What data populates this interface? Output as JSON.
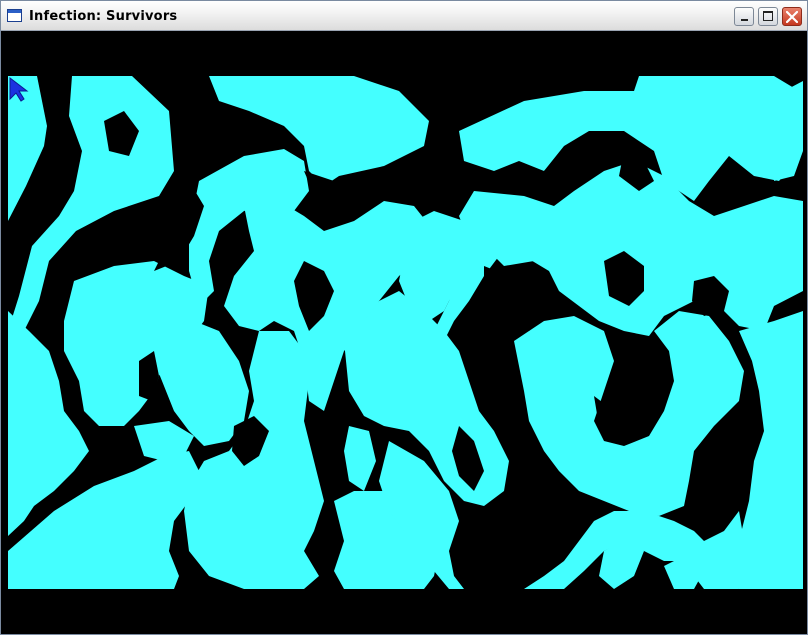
{
  "window": {
    "title": "Infection: Survivors",
    "controls": {
      "minimize_icon": "minimize-icon",
      "maximize_icon": "maximize-icon",
      "close_icon": "close-icon"
    }
  },
  "game": {
    "background_color": "#000000",
    "terrain_color": "#44ffff",
    "cursor_color": "#1b32e0"
  }
}
